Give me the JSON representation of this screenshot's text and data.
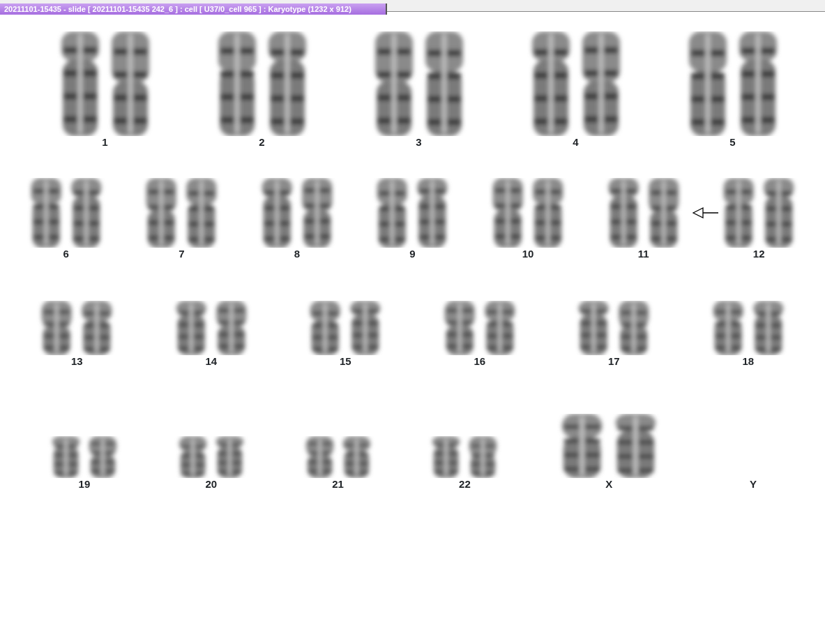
{
  "window": {
    "title": "20211101-15435 - slide [ 20211101-15435 242_6 ] : cell [ U37/0_cell 965 ] : Karyotype  (1232 x 912)"
  },
  "rows": [
    [
      {
        "label": "1",
        "kind": "pair",
        "arrow": false
      },
      {
        "label": "2",
        "kind": "pair",
        "arrow": false
      },
      {
        "label": "3",
        "kind": "pair",
        "arrow": false
      },
      {
        "label": "4",
        "kind": "pair",
        "arrow": false
      },
      {
        "label": "5",
        "kind": "pair",
        "arrow": false
      }
    ],
    [
      {
        "label": "6",
        "kind": "pair",
        "arrow": false
      },
      {
        "label": "7",
        "kind": "pair",
        "arrow": false
      },
      {
        "label": "8",
        "kind": "pair",
        "arrow": false
      },
      {
        "label": "9",
        "kind": "pair",
        "arrow": false
      },
      {
        "label": "10",
        "kind": "pair",
        "arrow": false
      },
      {
        "label": "11",
        "kind": "pair",
        "arrow": true
      },
      {
        "label": "12",
        "kind": "pair",
        "arrow": false
      }
    ],
    [
      {
        "label": "13",
        "kind": "pair",
        "arrow": false
      },
      {
        "label": "14",
        "kind": "pair",
        "arrow": false
      },
      {
        "label": "15",
        "kind": "pair",
        "arrow": false
      },
      {
        "label": "16",
        "kind": "pair",
        "arrow": false
      },
      {
        "label": "17",
        "kind": "pair",
        "arrow": false
      },
      {
        "label": "18",
        "kind": "pair",
        "arrow": false
      }
    ],
    [
      {
        "label": "19",
        "kind": "pair",
        "arrow": false
      },
      {
        "label": "20",
        "kind": "pair",
        "arrow": false
      },
      {
        "label": "21",
        "kind": "pair",
        "arrow": false
      },
      {
        "label": "22",
        "kind": "pair",
        "arrow": false
      },
      {
        "label": "X",
        "kind": "large",
        "arrow": false
      },
      {
        "label": "Y",
        "kind": "absent",
        "arrow": false
      }
    ]
  ]
}
